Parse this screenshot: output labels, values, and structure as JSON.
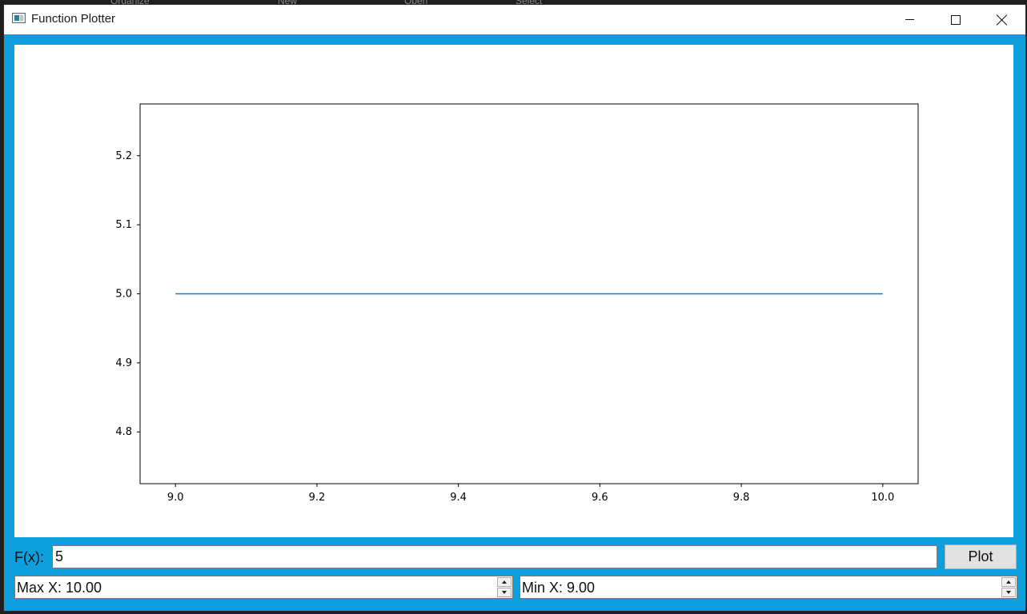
{
  "background_menu": [
    "Organize",
    "New",
    "Open",
    "Select"
  ],
  "window": {
    "title": "Function Plotter",
    "icon": "app-window-icon"
  },
  "titlebar_buttons": {
    "minimize_icon": "minimize-icon",
    "maximize_icon": "maximize-icon",
    "close_icon": "close-icon"
  },
  "inputs": {
    "fx_label": "F(x):",
    "fx_value": "5",
    "plot_button": "Plot",
    "max_x": "Max X: 10.00",
    "min_x": "Min X: 9.00"
  },
  "colors": {
    "accent": "#0d9fdb",
    "line": "#1f77b4"
  },
  "chart_data": {
    "type": "line",
    "title": "",
    "xlabel": "",
    "ylabel": "",
    "x": [
      9.0,
      10.0
    ],
    "series": [
      {
        "values": [
          5.0,
          5.0
        ]
      }
    ],
    "xlim": [
      8.95,
      10.05
    ],
    "ylim": [
      4.725,
      5.275
    ],
    "xticks": [
      "9.0",
      "9.2",
      "9.4",
      "9.6",
      "9.8",
      "10.0"
    ],
    "yticks": [
      "4.8",
      "4.9",
      "5.0",
      "5.1",
      "5.2"
    ],
    "grid": false
  }
}
